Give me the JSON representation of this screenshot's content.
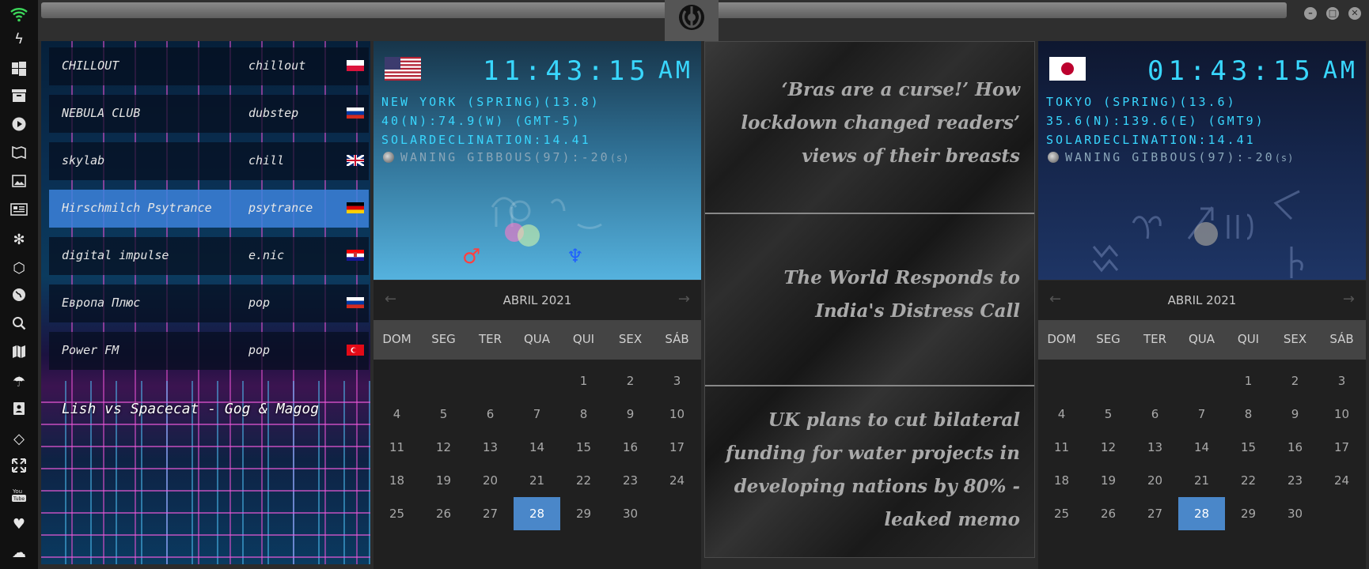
{
  "dock": {
    "icons": [
      "wifi-icon",
      "bolt-icon",
      "windows-icon",
      "archive-icon",
      "play-icon",
      "map-book-icon",
      "image-icon",
      "news-icon",
      "settings-badge-icon",
      "hexagon-icon",
      "globe-icon",
      "search-icon",
      "map-icon",
      "umbrella-icon",
      "contact-card-icon",
      "code-icon",
      "expand-icon",
      "youtube-icon",
      "heart-icon",
      "cloud-icon"
    ]
  },
  "radio": {
    "stations": [
      {
        "name": "CHILLOUT",
        "genre": "chillout",
        "flag": "PL"
      },
      {
        "name": "NEBULA CLUB",
        "genre": "dubstep",
        "flag": "RU"
      },
      {
        "name": "skylab",
        "genre": "chill",
        "flag": "GB"
      },
      {
        "name": "Hirschmilch Psytrance",
        "genre": "psytrance",
        "flag": "DE"
      },
      {
        "name": "digital impulse",
        "genre": "e.nic",
        "flag": "HR"
      },
      {
        "name": "Европа Плюс",
        "genre": "pop",
        "flag": "RU"
      },
      {
        "name": "Power FM",
        "genre": "pop",
        "flag": "TR"
      }
    ],
    "now_playing": "Lish vs Spacecat - Gog & Magog"
  },
  "clocks": [
    {
      "flag": "US",
      "time": "11:43:15",
      "ampm": "AM",
      "city": "NEW YORK (SPRING)(13.8)",
      "coords": "40(N):74.9(W) (GMT-5)",
      "solar": "SOLARDECLINATION:14.41",
      "moon": "WANING GIBBOUS(97):-20",
      "moon_unit": "(s)"
    },
    {
      "flag": "JP",
      "time": "01:43:15",
      "ampm": "AM",
      "city": "TOKYO (SPRING)(13.6)",
      "coords": "35.6(N):139.6(E) (GMT9)",
      "solar": "SOLARDECLINATION:14.41",
      "moon": "WANING GIBBOUS(97):-20",
      "moon_unit": "(s)"
    }
  ],
  "calendar": {
    "month": "ABRIL 2021",
    "weekdays": [
      "DOM",
      "SEG",
      "TER",
      "QUA",
      "QUI",
      "SEX",
      "SÁB"
    ],
    "days": [
      "1",
      "2",
      "3",
      "4",
      "5",
      "6",
      "7",
      "8",
      "9",
      "10",
      "11",
      "12",
      "13",
      "14",
      "15",
      "16",
      "17",
      "18",
      "19",
      "20",
      "21",
      "22",
      "23",
      "24",
      "25",
      "26",
      "27",
      "28",
      "29",
      "30"
    ],
    "first_weekday": 4,
    "selected": "28"
  },
  "news": [
    "‘Bras are a curse!’ How lockdown changed readers’ views of their breasts",
    "The World Responds to India's Distress Call",
    "UK plans to cut bilateral funding for water projects in developing nations by 80% - leaked memo"
  ],
  "colors": {
    "accent": "#4a87c9",
    "clock_text": "#39d7ff",
    "calendar_bg": "#202020"
  }
}
